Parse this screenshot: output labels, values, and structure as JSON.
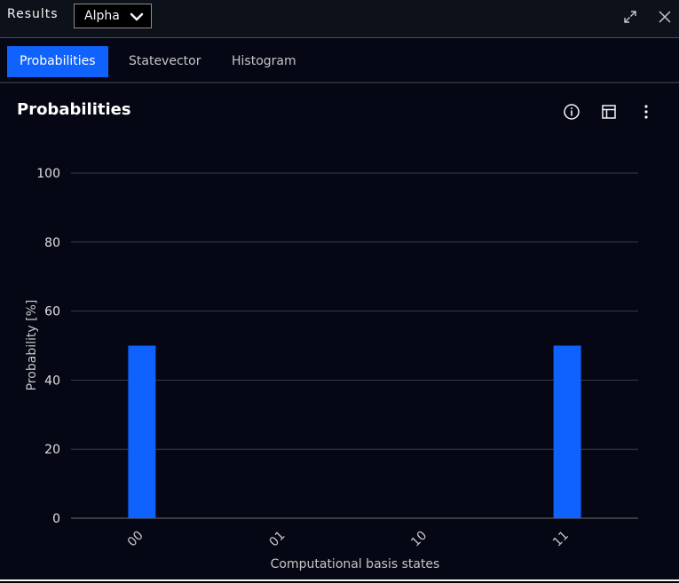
{
  "topbar": {
    "title": "Results",
    "dropdown_value": "Alpha",
    "icons": [
      "chevron-down-icon",
      "expand-icon",
      "close-icon"
    ]
  },
  "tabs": [
    {
      "label": "Probabilities",
      "active": true
    },
    {
      "label": "Statevector",
      "active": false
    },
    {
      "label": "Histogram",
      "active": false
    }
  ],
  "card": {
    "title": "Probabilities",
    "toolbar_icons": [
      "info-icon",
      "table-view-icon",
      "overflow-menu-icon"
    ]
  },
  "colors": {
    "accent": "#0f62fe",
    "bar": "#0f62fe",
    "background": "#050814",
    "grid": "#393d47"
  },
  "chart_data": {
    "type": "bar",
    "categories": [
      "00",
      "01",
      "10",
      "11"
    ],
    "values": [
      50,
      0,
      0,
      50
    ],
    "xlabel": "Computational basis states",
    "ylabel": "Probability [%]",
    "ylim": [
      0,
      100
    ],
    "yticks": [
      0,
      20,
      40,
      60,
      80,
      100
    ],
    "grid": true
  }
}
